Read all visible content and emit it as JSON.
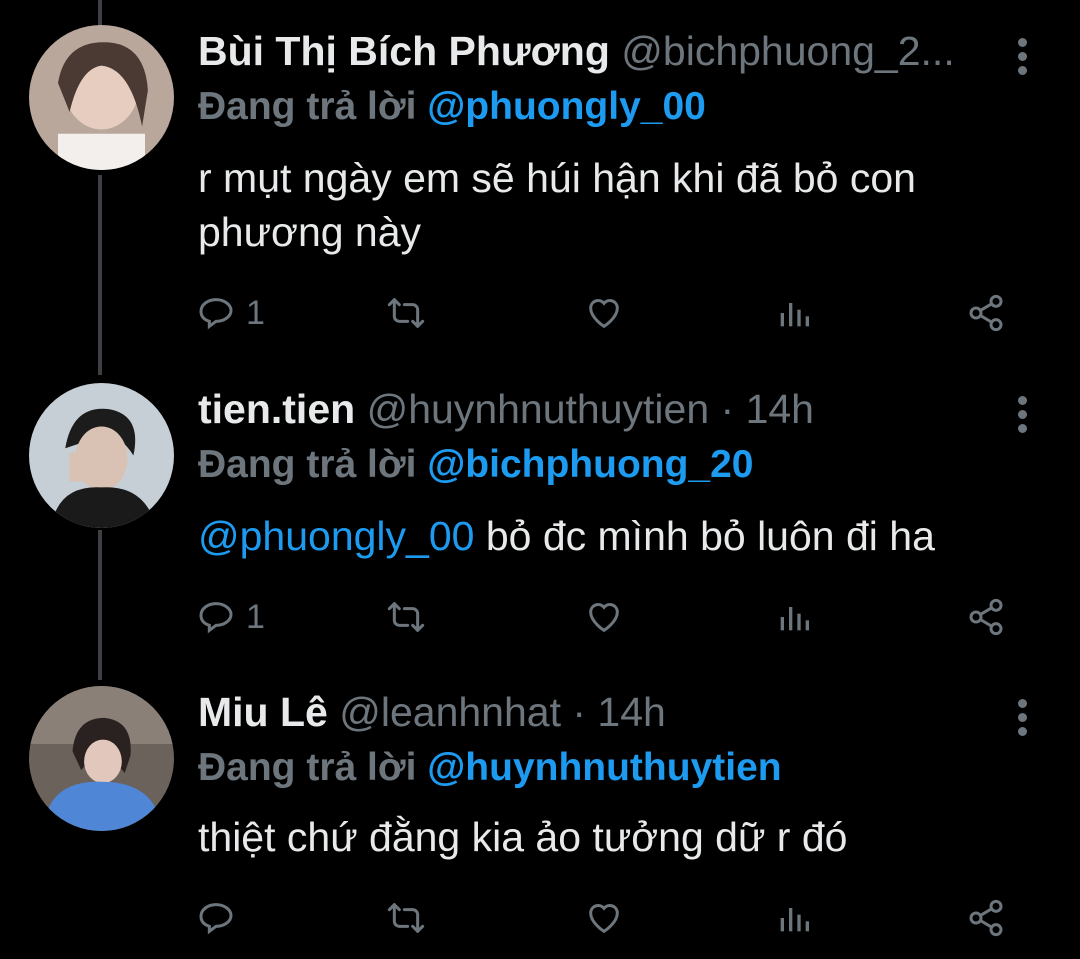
{
  "tweets": [
    {
      "display_name": "Bùi Thị Bích Phương",
      "handle": "@bichphuong_2...",
      "time": "",
      "replying_label": "Đang trả lời",
      "replying_to": "@phuongly_00",
      "text_mention": "",
      "text": "r mụt ngày em sẽ húi hận khi đã bỏ con phương này",
      "reply_count": "1",
      "retweet_count": "",
      "like_count": ""
    },
    {
      "display_name": "tien.tien",
      "handle": "@huynhnuthuytien",
      "time": " · 14h",
      "replying_label": "Đang trả lời",
      "replying_to": "@bichphuong_20",
      "text_mention": "@phuongly_00",
      "text": " bỏ đc mình bỏ luôn đi ha",
      "reply_count": "1",
      "retweet_count": "",
      "like_count": ""
    },
    {
      "display_name": "Miu Lê",
      "handle": "@leanhnhat",
      "time": " · 14h",
      "replying_label": "Đang trả lời",
      "replying_to": "@huynhnuthuytien",
      "text_mention": "",
      "text": "thiệt chứ đằng kia ảo tưởng dữ r đó",
      "reply_count": "",
      "retweet_count": "",
      "like_count": ""
    }
  ],
  "icons": [
    "reply-icon",
    "retweet-icon",
    "like-icon",
    "views-icon",
    "share-icon",
    "more-icon"
  ],
  "colors": {
    "background": "#000000",
    "text": "#e7e9ea",
    "muted": "#6e767d",
    "accent": "#1d9bf0"
  }
}
